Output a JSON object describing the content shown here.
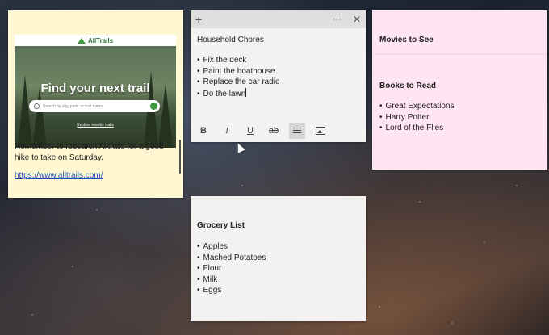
{
  "yellow_note": {
    "preview": {
      "brand": "AllTrails",
      "headline": "Find your next trail",
      "search_placeholder": "Search by city, park, or trail name",
      "explore_link": "Explore nearby trails"
    },
    "text": "Remember to research Alltrails for a good hike to take on Saturday.",
    "link": "https://www.alltrails.com/"
  },
  "household_note": {
    "title": "Household Chores",
    "items": [
      "Fix the deck",
      "Paint the boathouse",
      "Replace the car radio",
      "Do the lawn"
    ],
    "toolbar": {
      "add": "+",
      "more": "···",
      "close": "✕"
    },
    "format": {
      "bold": "B",
      "italic": "I",
      "underline": "U",
      "strike": "ab"
    }
  },
  "movies_note": {
    "title": "Movies to See"
  },
  "books_note": {
    "title": "Books to Read",
    "items": [
      "Great Expectations",
      "Harry Potter",
      "Lord of the Flies"
    ]
  },
  "grocery_note": {
    "title": "Grocery List",
    "items": [
      "Apples",
      "Mashed Potatoes",
      "Flour",
      "Milk",
      "Eggs"
    ]
  },
  "colors": {
    "yellow": "#fff7d1",
    "pink": "#ffe4f1",
    "neutral": "#f3f2f1",
    "link": "#1a4fb5"
  }
}
